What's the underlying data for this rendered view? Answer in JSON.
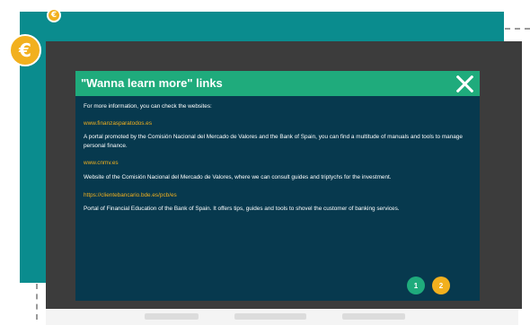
{
  "badges": {
    "small_symbol": "€",
    "large_symbol": "€"
  },
  "modal": {
    "title": "\"Wanna learn more\" links",
    "intro": "For more information, you can check the websites:",
    "links": [
      {
        "url": "www.finanzasparatodos.es",
        "description": "A portal promoted by the Comisión Nacional del Mercado de Valores and the Bank of Spain, you can find a multitude of manuals and tools to manage personal finance."
      },
      {
        "url": "www.cnmv.es",
        "description": "Website of the Comisión Nacional del Mercado de Valores, where we can consult guides and triptychs for the investment."
      },
      {
        "url": "https://clientebancario.bde.es/pcb/es",
        "description": "Portal of Financial Education of the Bank of Spain. It offers tips, guides and tools to shovel the customer of banking services."
      }
    ],
    "pagination": [
      {
        "label": "1",
        "color": "#1fab7c"
      },
      {
        "label": "2",
        "color": "#f2b01e"
      }
    ]
  },
  "colors": {
    "teal": "#0a8c8e",
    "header_green": "#1fab7c",
    "modal_navy": "#07394e",
    "accent_yellow": "#f2b01e"
  }
}
